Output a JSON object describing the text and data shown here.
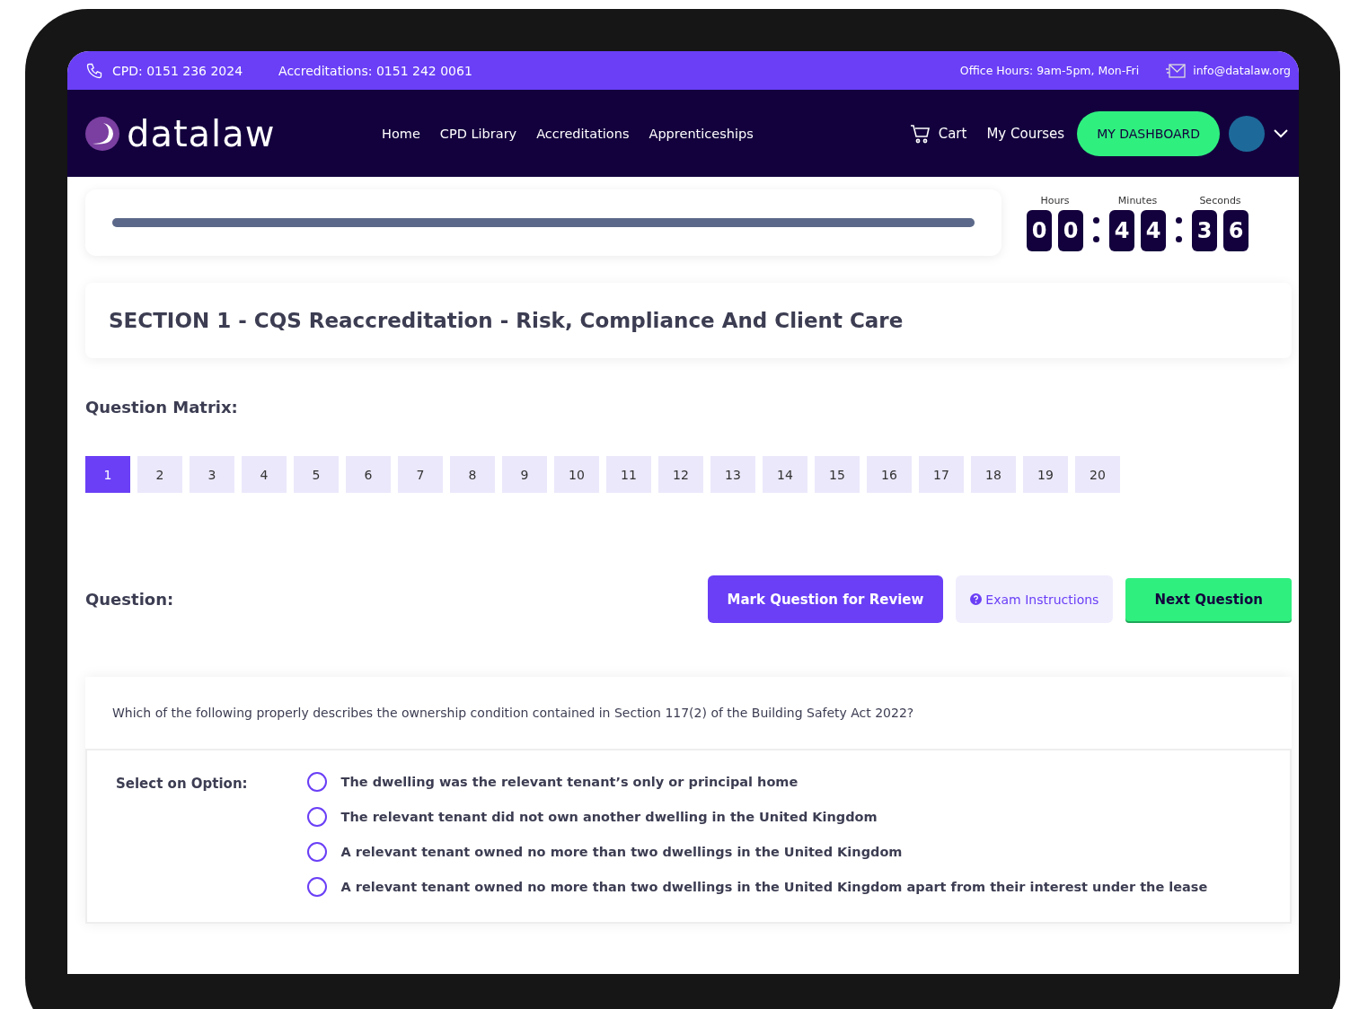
{
  "top_bar": {
    "phones": [
      "CPD: 0151 236 2024",
      "Accreditations: 0151 242 0061"
    ],
    "hours": "Office Hours: 9am-5pm, Mon-Fri",
    "email": "info@datalaw.org"
  },
  "nav": {
    "logo": "datalaw",
    "links": [
      "Home",
      "CPD Library",
      "Accreditations",
      "Apprenticeships"
    ],
    "cart": "Cart",
    "my_courses": "My Courses",
    "dashboard": "MY DASHBOARD"
  },
  "progress": {
    "level": 1
  },
  "timer": [
    {
      "label": "Hours",
      "digits": [
        "0",
        "0"
      ]
    },
    {
      "label": "Minutes",
      "digits": [
        "4",
        "4"
      ]
    },
    {
      "label": "Seconds",
      "digits": [
        "3",
        "6"
      ]
    }
  ],
  "section_title": "SECTION 1 - CQS Reaccreditation - Risk, Compliance And Client Care",
  "matrix": {
    "title": "Question Matrix:",
    "questions": [
      {
        "label": "1",
        "selected": true
      },
      {
        "label": "2",
        "selected": false
      },
      {
        "label": "3",
        "selected": false
      },
      {
        "label": "4",
        "selected": false
      },
      {
        "label": "5",
        "selected": false
      },
      {
        "label": "6",
        "selected": false
      },
      {
        "label": "7",
        "selected": false
      },
      {
        "label": "8",
        "selected": false
      },
      {
        "label": "9",
        "selected": false
      },
      {
        "label": "10",
        "selected": false
      },
      {
        "label": "11",
        "selected": false
      },
      {
        "label": "12",
        "selected": false
      },
      {
        "label": "13",
        "selected": false
      },
      {
        "label": "14",
        "selected": false
      },
      {
        "label": "15",
        "selected": false
      },
      {
        "label": "16",
        "selected": false
      },
      {
        "label": "17",
        "selected": false
      },
      {
        "label": "18",
        "selected": false
      },
      {
        "label": "19",
        "selected": false
      },
      {
        "label": "20",
        "selected": false
      }
    ]
  },
  "question": {
    "heading": "Question:",
    "buttons": {
      "review": "Mark Question for Review",
      "instructions": "Exam Instructions",
      "next": "Next Question"
    },
    "text": "Which of the following properly describes the ownership condition contained in Section 117(2) of the Building Safety Act 2022?",
    "options_label": "Select on Option:",
    "options": [
      {
        "text": "The dwelling was the relevant tenant’s only or principal home",
        "selected": false
      },
      {
        "text": "The relevant tenant did not own another dwelling in the United Kingdom",
        "selected": false
      },
      {
        "text": "A relevant tenant owned no more than two dwellings in the United Kingdom",
        "selected": false
      },
      {
        "text": "A relevant tenant owned no more than two dwellings in the United Kingdom apart from their interest under the lease",
        "selected": false
      }
    ]
  }
}
